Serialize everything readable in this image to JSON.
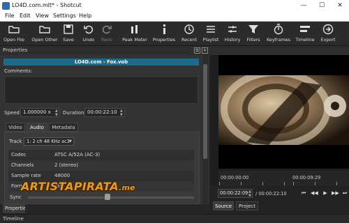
{
  "window": {
    "title": "LO4D.com.mlt* - Shotcut",
    "controls": [
      "—",
      "☐",
      "✕"
    ]
  },
  "menu": [
    "File",
    "Edit",
    "View",
    "Settings",
    "Help"
  ],
  "toolbar": [
    {
      "label": "Open File",
      "icon": "folder-open-icon"
    },
    {
      "label": "Open Other",
      "icon": "folder-open-icon"
    },
    {
      "label": "Save",
      "icon": "save-icon"
    },
    {
      "label": "Undo",
      "icon": "undo-icon"
    },
    {
      "label": "Redo",
      "icon": "redo-icon"
    },
    {
      "label": "Peak Meter",
      "icon": "peak-meter-icon"
    },
    {
      "label": "Properties",
      "icon": "info-icon"
    },
    {
      "label": "Recent",
      "icon": "clock-icon"
    },
    {
      "label": "Playlist",
      "icon": "list-icon"
    },
    {
      "label": "History",
      "icon": "history-icon"
    },
    {
      "label": "Filters",
      "icon": "filter-icon"
    },
    {
      "label": "Keyframes",
      "icon": "stopwatch-icon"
    },
    {
      "label": "Timeline",
      "icon": "timeline-icon"
    },
    {
      "label": "Export",
      "icon": "export-icon"
    }
  ],
  "properties": {
    "panel_title": "Properties",
    "clip_name": "LO4D.com - Fox.vob",
    "comments_label": "Comments:",
    "speed_label": "Speed",
    "speed_value": "1.000000 x",
    "duration_label": "Duration",
    "duration_value": "00:00:22:10",
    "tabs": [
      "Video",
      "Audio",
      "Metadata"
    ],
    "active_tab": "Audio",
    "track_label": "Track",
    "track_value": "1: 2 ch 48 KHz ac3",
    "rows": [
      {
        "key": "Codec",
        "value": "ATSC A/52A (AC-3)"
      },
      {
        "key": "Channels",
        "value": "2 (stereo)"
      },
      {
        "key": "Sample rate",
        "value": "48000"
      },
      {
        "key": "Format",
        "value": "fltp"
      }
    ],
    "sync_label": "Sync",
    "bottom_tab": "Properties"
  },
  "watermark": {
    "main": "ARTISTAPIRATA",
    "suffix": ".me"
  },
  "player": {
    "ruler_start": "00:00:00:00",
    "ruler_mid": "00:00:09:29",
    "current_time": "00:00:22:09",
    "total_time": "/ 00:00:22:10",
    "source_tab": "Source",
    "project_tab": "Project"
  },
  "timeline_label": "Timeline"
}
